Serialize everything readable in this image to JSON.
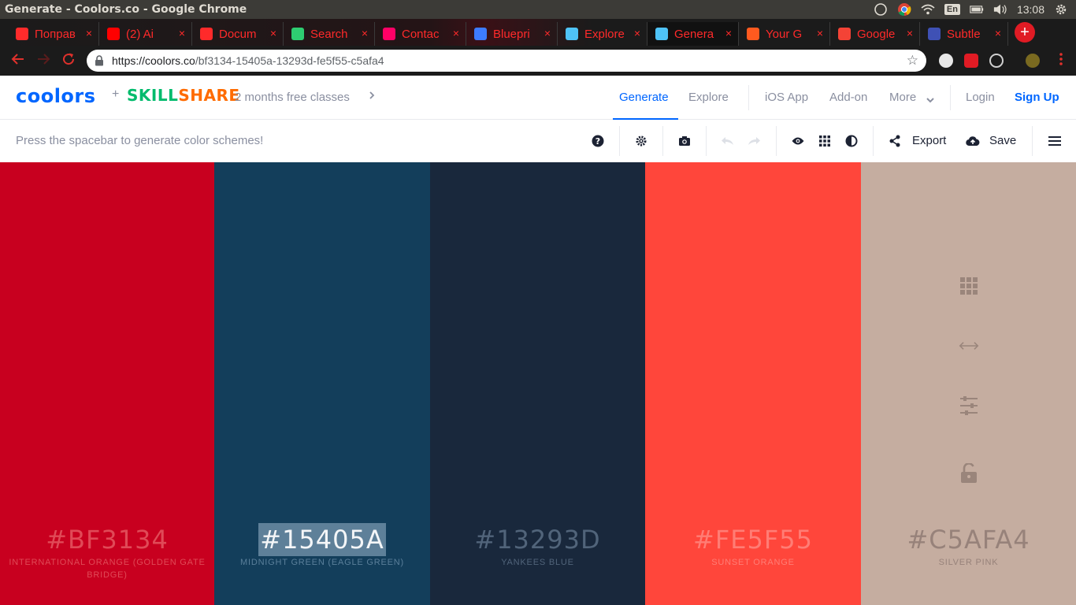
{
  "os": {
    "window_title": "Generate - Coolors.co - Google Chrome",
    "lang": "En",
    "clock": "13:08"
  },
  "browser": {
    "tabs": [
      {
        "label": "Поправ",
        "favicon_color": "#ff2b2b"
      },
      {
        "label": "(2) Ai",
        "favicon_color": "#ff0000"
      },
      {
        "label": "Docum",
        "favicon_color": "#ff2a2a"
      },
      {
        "label": "Search",
        "favicon_color": "#2ecc71"
      },
      {
        "label": "Contac",
        "favicon_color": "#ff0066"
      },
      {
        "label": "Bluepri",
        "favicon_color": "#3d7bff"
      },
      {
        "label": "Explore",
        "favicon_color": "#4fc3f7"
      },
      {
        "label": "Genera",
        "favicon_color": "#4fc3f7"
      },
      {
        "label": "Your G",
        "favicon_color": "#ff5a1f"
      },
      {
        "label": "Google",
        "favicon_color": "#f44336"
      },
      {
        "label": "Subtle",
        "favicon_color": "#3f51b5"
      }
    ],
    "close_glyph": "×",
    "new_tab_glyph": "+",
    "url_host": "https://coolors.co",
    "url_path": "/bf3134-15405a-13293d-fe5f55-c5afa4"
  },
  "header": {
    "logo": "coolors",
    "plus": "+",
    "partner_a": "SKILL",
    "partner_b": "SHARE",
    "promo": "2 months free classes",
    "nav": {
      "generate": "Generate",
      "explore": "Explore",
      "ios_app": "iOS App",
      "add_on": "Add-on",
      "more": "More",
      "login": "Login",
      "signup": "Sign Up"
    }
  },
  "toolbar": {
    "hint": "Press the spacebar to generate color schemes!",
    "export": "Export",
    "save": "Save"
  },
  "palette": [
    {
      "hex": "#BF3134",
      "name": "INTERNATIONAL ORANGE (GOLDEN GATE BRIDGE)",
      "bg": "#c8001f",
      "text": "#e04a57",
      "selected": false
    },
    {
      "hex": "#15405A",
      "name": "MIDNIGHT GREEN (EAGLE GREEN)",
      "bg": "#133e5b",
      "text": "#5a7f9a",
      "selected": true
    },
    {
      "hex": "#13293D",
      "name": "YANKEES BLUE",
      "bg": "#19283c",
      "text": "#51647a",
      "selected": false
    },
    {
      "hex": "#FE5F55",
      "name": "SUNSET ORANGE",
      "bg": "#ff463b",
      "text": "#ff7d75",
      "selected": false
    },
    {
      "hex": "#C5AFA4",
      "name": "SILVER PINK",
      "bg": "#c5ada0",
      "text": "#97827a",
      "selected": false
    }
  ],
  "colors": {
    "accent": "#0066ff",
    "muted": "#8a8fa0",
    "selection_bg": "#5e8099"
  }
}
